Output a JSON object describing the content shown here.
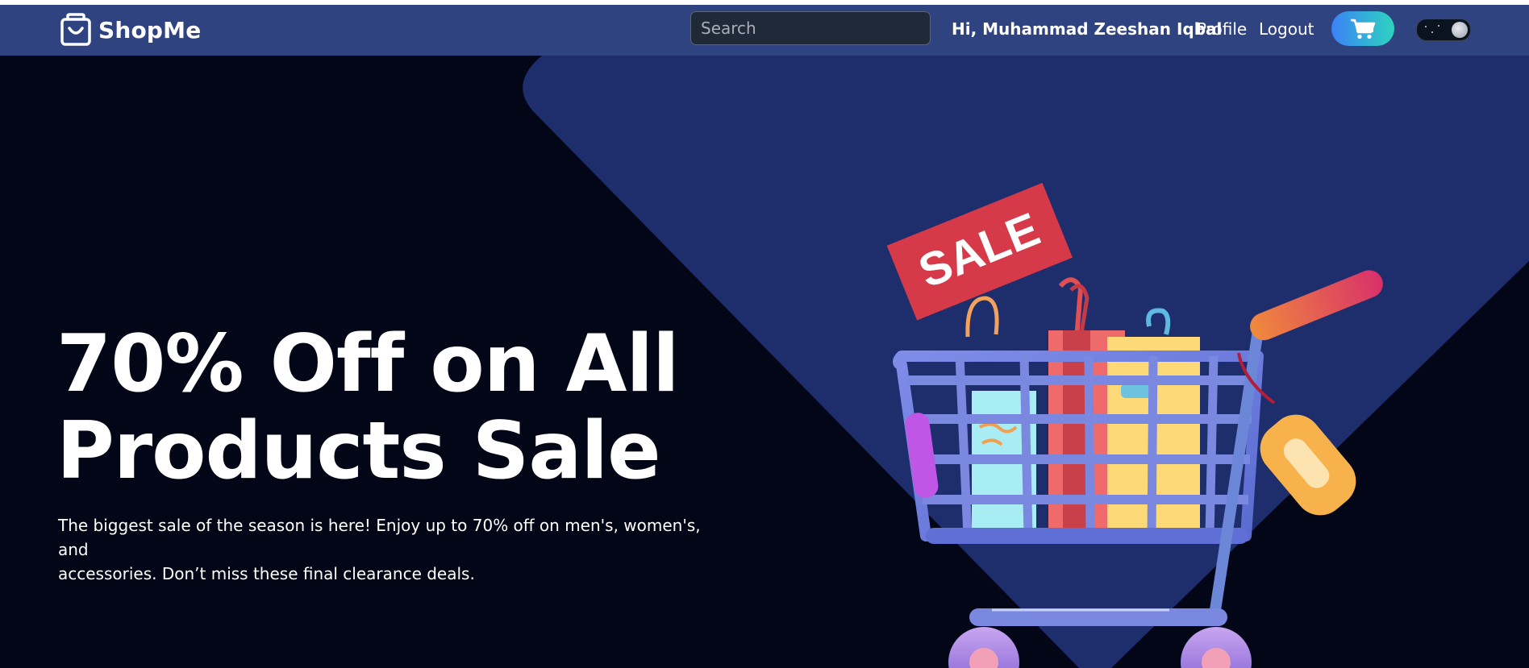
{
  "colors": {
    "navbar": "#2f4380",
    "hero_background": "#030616",
    "hero_shape": "#1e2d6b",
    "cart_gradient_start": "#3b82f6",
    "cart_gradient_end": "#2dd4bf",
    "sale_tag": "#d63a48"
  },
  "navbar": {
    "brand": {
      "icon": "shopping-bag-icon",
      "name": "ShopMe"
    },
    "search": {
      "placeholder": "Search",
      "value": ""
    },
    "greeting": "Hi, Muhammad Zeeshan Iqbal",
    "links": {
      "profile": "Profile",
      "logout": "Logout"
    },
    "cart_icon": "shopping-cart-icon",
    "theme_toggle": {
      "state": "dark"
    }
  },
  "hero": {
    "headline_line1": "70% Off on All",
    "headline_line2": "Products Sale",
    "description_line1": "The biggest sale of the season is here! Enjoy up to 70% off on men's, women's, and",
    "description_line2": "accessories. Don’t miss these final clearance deals.",
    "illustration": {
      "icon": "shopping-cart-illustration",
      "sale_tag_text": "SALE"
    }
  }
}
